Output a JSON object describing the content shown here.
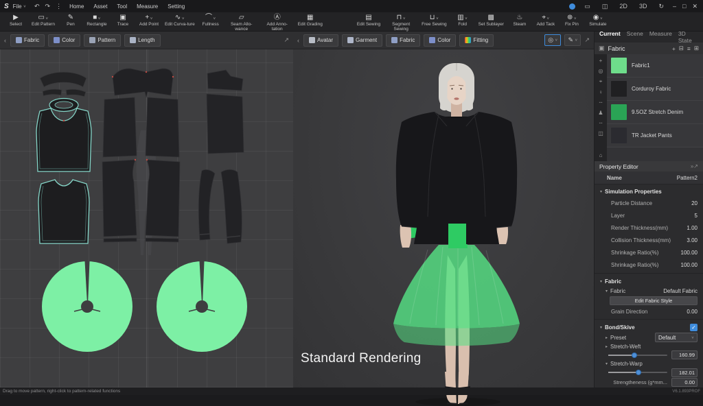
{
  "colors": {
    "pattern_green": "#7df0a5",
    "green_bright": "#2ecb63",
    "skirt_green": "#55e084",
    "outline_teal": "#85d6c8",
    "accent_blue": "#3f8cdc"
  },
  "icons": {
    "caret": "∨",
    "tri_down": "▾",
    "tri_right": "▸",
    "back": "‹",
    "chevrons": "»",
    "expand": "↗",
    "undo": "↶",
    "redo": "↷",
    "kebab": "⋮",
    "check": "✓",
    "plus": "+",
    "trash": "⊟",
    "list": "≡",
    "grid": "⊞",
    "minimize": "–",
    "maximize": "□",
    "close": "✕",
    "refresh": "↻",
    "panel": "▭",
    "split": "◫",
    "checkbox": "▣",
    "target": "◎",
    "brush": "✎",
    "box": "⌂"
  },
  "titlebar": {
    "logo": "S",
    "file_menu": "File",
    "menus": [
      {
        "label": "Home"
      },
      {
        "label": "Asset"
      },
      {
        "label": "Tool"
      },
      {
        "label": "Measure"
      },
      {
        "label": "Setting"
      }
    ],
    "view_2d": "2D",
    "view_3d": "3D"
  },
  "toolbar": {
    "group1": [
      {
        "label": "Select",
        "glyph": "▶",
        "caret": false,
        "name": "tool-select"
      },
      {
        "label": "Edit Pattern",
        "glyph": "▭",
        "caret": true,
        "name": "tool-edit-pattern"
      },
      {
        "label": "Pen",
        "glyph": "✎",
        "caret": false,
        "name": "tool-pen"
      },
      {
        "label": "Rectangle",
        "glyph": "■",
        "caret": true,
        "name": "tool-rectangle"
      },
      {
        "label": "Trace",
        "glyph": "▣",
        "caret": false,
        "name": "tool-trace"
      },
      {
        "label": "Add Point",
        "glyph": "+",
        "caret": true,
        "name": "tool-add-point"
      },
      {
        "label": "Edit Curva-ture",
        "glyph": "∿",
        "caret": true,
        "name": "tool-edit-curvature"
      },
      {
        "label": "Fullness",
        "glyph": "⌒",
        "caret": true,
        "name": "tool-fullness"
      },
      {
        "label": "Seam Allo-wance",
        "glyph": "▱",
        "caret": false,
        "name": "tool-seam-allowance"
      },
      {
        "label": "Add Anno-tation",
        "glyph": "Ⓐ",
        "caret": false,
        "name": "tool-add-annotation"
      },
      {
        "label": "Edit Grading",
        "glyph": "▦",
        "caret": false,
        "name": "tool-edit-grading"
      }
    ],
    "group2": [
      {
        "label": "Edit Sewing",
        "glyph": "▤",
        "caret": false,
        "name": "tool-edit-sewing"
      },
      {
        "label": "Segment Sewing",
        "glyph": "⊓",
        "caret": true,
        "name": "tool-segment-sewing"
      },
      {
        "label": "Free Sewing",
        "glyph": "⊔",
        "caret": true,
        "name": "tool-free-sewing"
      },
      {
        "label": "Fold",
        "glyph": "▥",
        "caret": true,
        "name": "tool-fold"
      },
      {
        "label": "Set Sublayer",
        "glyph": "▩",
        "caret": false,
        "name": "tool-set-sublayer"
      },
      {
        "label": "Steam",
        "glyph": "♨",
        "caret": false,
        "name": "tool-steam"
      },
      {
        "label": "Add Tack",
        "glyph": "⌖",
        "caret": true,
        "name": "tool-add-tack"
      },
      {
        "label": "Fix Pin",
        "glyph": "⊕",
        "caret": true,
        "name": "tool-fix-pin"
      },
      {
        "label": "Simulate",
        "glyph": "◉",
        "caret": true,
        "name": "tool-simulate"
      }
    ]
  },
  "view2d": {
    "tabs": [
      {
        "label": "Fabric",
        "icon_color": "#8f9fc5",
        "name": "tab-2d-fabric"
      },
      {
        "label": "Color",
        "icon_color": "#7d8fc9",
        "name": "tab-2d-color"
      },
      {
        "label": "Pattern",
        "icon_color": "#9aa3b5",
        "name": "tab-2d-pattern"
      },
      {
        "label": "Length",
        "icon_color": "#aab3c5",
        "name": "tab-2d-length"
      }
    ]
  },
  "view3d": {
    "tabs": [
      {
        "label": "Avatar",
        "icon_color": "#b8bdc6",
        "name": "tab-3d-avatar"
      },
      {
        "label": "Garment",
        "icon_color": "#aeb6c9",
        "name": "tab-3d-garment"
      },
      {
        "label": "Fabric",
        "icon_color": "#8f9fc5",
        "name": "tab-3d-fabric"
      },
      {
        "label": "Color",
        "icon_color": "#7d8fc9",
        "name": "tab-3d-color"
      },
      {
        "label": "Fitting",
        "icon_color": "linear-gradient(90deg,#e74c3c,#f1c40f,#2ecc71,#3498db)",
        "name": "tab-3d-fitting"
      }
    ],
    "overlay": "Standard Rendering"
  },
  "right_panel": {
    "tabs": [
      {
        "label": "Current",
        "active": true,
        "name": "rtab-current"
      },
      {
        "label": "Scene",
        "active": false,
        "name": "rtab-scene"
      },
      {
        "label": "Measure",
        "active": false,
        "name": "rtab-measure"
      },
      {
        "label": "3D State",
        "active": false,
        "name": "rtab-3d-state"
      }
    ],
    "browser": {
      "title": "Fabric",
      "tool_icons": [
        {
          "glyph": "+",
          "name": "transform-icon"
        },
        {
          "glyph": "◎",
          "name": "world-icon"
        },
        {
          "glyph": "⌖",
          "name": "pin-icon"
        },
        {
          "glyph": "♀",
          "name": "lamp-icon"
        },
        {
          "glyph": "┄",
          "name": "seam-dash-icon"
        },
        {
          "glyph": "♟",
          "name": "avatar-icon"
        },
        {
          "glyph": "┄",
          "name": "stitch-dash-icon"
        },
        {
          "glyph": "◫",
          "name": "bracket-icon"
        }
      ],
      "items": [
        {
          "name": "Fabric1",
          "swatch": "#6edd8b"
        },
        {
          "name": "Corduroy Fabric",
          "swatch": "#202022"
        },
        {
          "name": "9.5OZ Stretch Denim",
          "swatch": "#2aa455"
        },
        {
          "name": "TR Jacket Pants",
          "swatch": "#2b2b30"
        }
      ]
    },
    "property_editor": {
      "title": "Property Editor",
      "name_label": "Name",
      "name_value": "Pattern2",
      "sim_title": "Simulation Properties",
      "sim_rows": [
        {
          "label": "Particle Distance",
          "value": "20"
        },
        {
          "label": "Layer",
          "value": "5"
        },
        {
          "label": "Render Thickness(mm)",
          "value": "1.00"
        },
        {
          "label": "Collision Thickness(mm)",
          "value": "3.00"
        },
        {
          "label": "Shrinkage Ratio(%)",
          "value": "100.00"
        },
        {
          "label": "Shrinkage Ratio(%)",
          "value": "100.00"
        }
      ],
      "fabric_title": "Fabric",
      "fabric_label": "Fabric",
      "fabric_value": "Default Fabric",
      "edit_fabric_button": "Edit  Fabric Style",
      "grain_label": "Grain Direction",
      "grain_value": "0.00",
      "bond_title": "Bond/Skive",
      "preset_label": "Preset",
      "preset_value": "Default",
      "stretch_weft_label": "Stretch-Weft",
      "stretch_weft_value": "160.99",
      "stretch_warp_label": "Stretch-Warp",
      "stretch_warp_value": "182.01",
      "strength_label": "Strengtheness  (g*mm...",
      "strength_value": "0.00"
    }
  },
  "statusbar": {
    "hint": "Drag to move pattern, right-click to pattern-related functions",
    "version": "V6.1.893PROF"
  }
}
